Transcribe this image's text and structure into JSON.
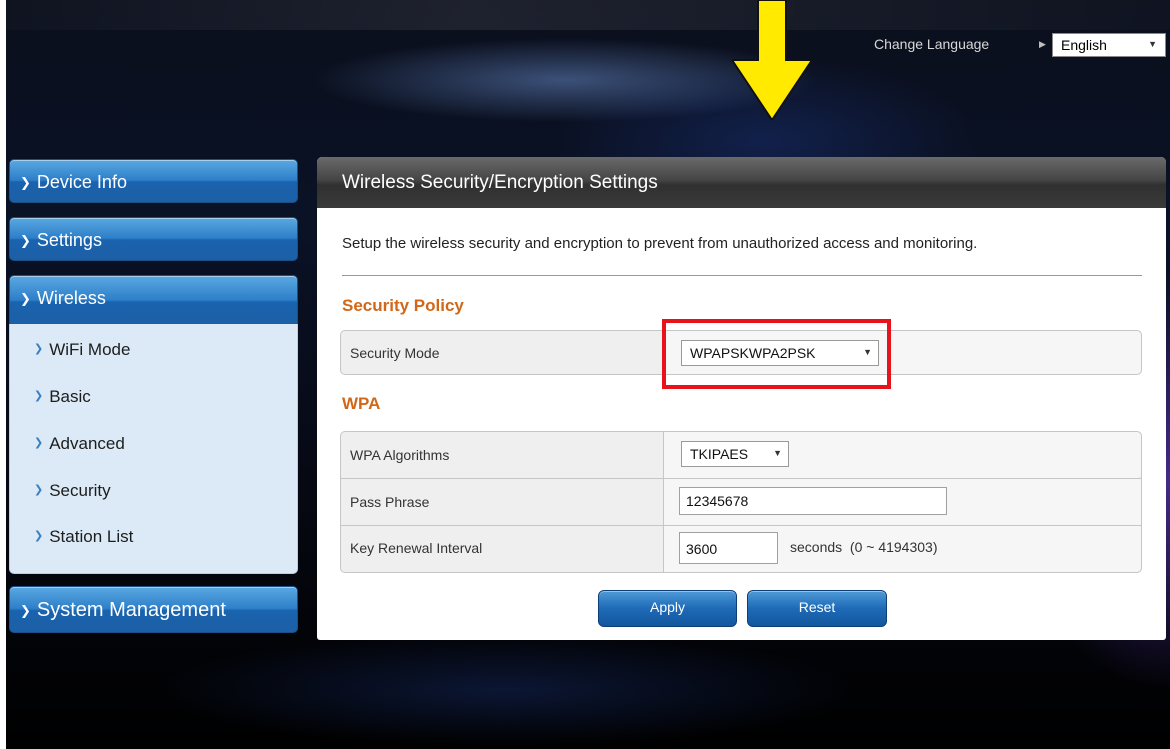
{
  "header": {
    "change_language_label": "Change Language",
    "language_value": "English"
  },
  "sidebar": {
    "items": [
      {
        "label": "Device Info"
      },
      {
        "label": "Settings"
      },
      {
        "label": "Wireless"
      },
      {
        "label": "System Management"
      }
    ],
    "wireless_submenu": [
      {
        "label": "WiFi Mode"
      },
      {
        "label": "Basic"
      },
      {
        "label": "Advanced"
      },
      {
        "label": "Security"
      },
      {
        "label": "Station List"
      }
    ]
  },
  "panel": {
    "title": "Wireless Security/Encryption Settings",
    "description": "Setup the wireless security and encryption to prevent from unauthorized access and monitoring.",
    "security_policy": {
      "section_title": "Security Policy",
      "security_mode_label": "Security Mode",
      "security_mode_value": "WPAPSKWPA2PSK"
    },
    "wpa": {
      "section_title": "WPA",
      "algorithms_label": "WPA Algorithms",
      "algorithms_value": "TKIPAES",
      "pass_phrase_label": "Pass Phrase",
      "pass_phrase_value": "12345678",
      "key_renewal_label": "Key Renewal Interval",
      "key_renewal_value": "3600",
      "key_renewal_unit": "seconds  (0 ~ 4194303)"
    },
    "buttons": {
      "apply": "Apply",
      "reset": "Reset"
    }
  },
  "annotations": {
    "arrow_color": "#ffea00",
    "highlight_color": "#e8121a"
  }
}
